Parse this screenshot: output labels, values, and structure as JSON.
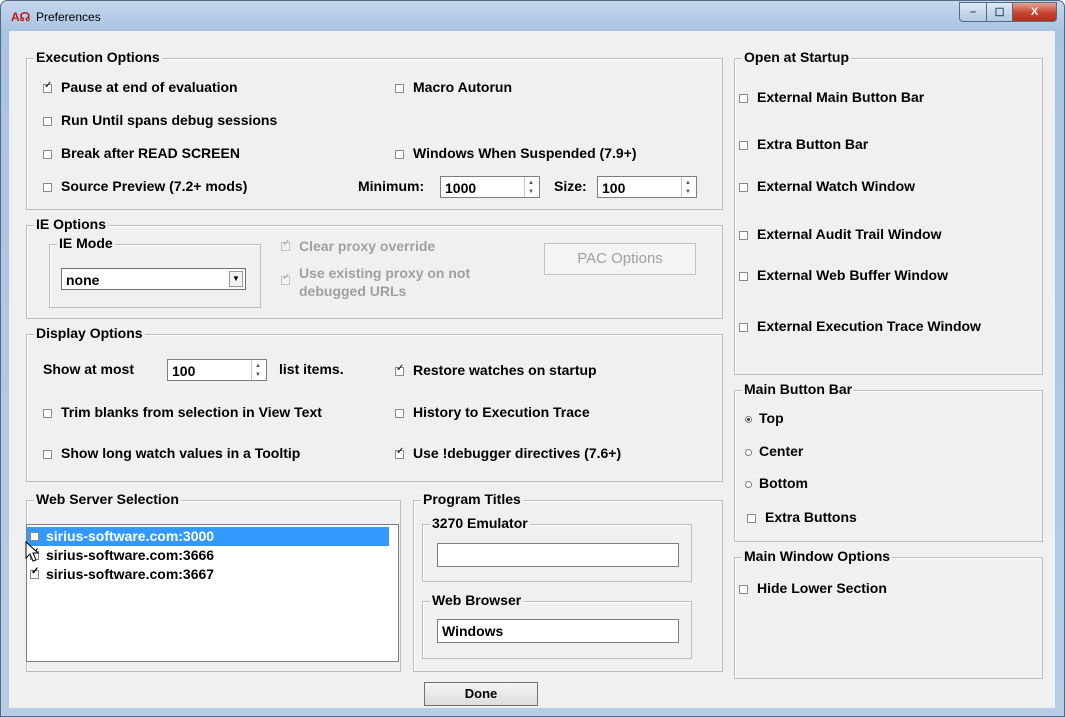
{
  "window": {
    "title": "Preferences",
    "controls": {
      "minimize": "–",
      "maximize": "☐",
      "close": "X"
    }
  },
  "execution_options": {
    "label": "Execution Options",
    "pause_at_end": {
      "label": "Pause at end of evaluation",
      "checked": true
    },
    "macro_autorun": {
      "label": "Macro Autorun",
      "checked": false
    },
    "run_until_spans": {
      "label": "Run Until spans debug sessions",
      "checked": false
    },
    "break_after_read_screen": {
      "label": "Break after READ SCREEN",
      "checked": false
    },
    "windows_when_suspended": {
      "label": "Windows When Suspended (7.9+)",
      "checked": false
    },
    "source_preview": {
      "label": "Source Preview (7.2+ mods)",
      "checked": false
    },
    "minimum_label": "Minimum:",
    "minimum_value": "1000",
    "size_label": "Size:",
    "size_value": "100"
  },
  "ie_options": {
    "label": "IE Options",
    "ie_mode_label": "IE Mode",
    "ie_mode_value": "none",
    "clear_proxy": {
      "label": "Clear proxy override",
      "checked": true
    },
    "use_existing_proxy": {
      "label_line1": "Use existing proxy on not",
      "label_line2": "debugged URLs",
      "checked": true
    },
    "pac_button": "PAC Options"
  },
  "display_options": {
    "label": "Display Options",
    "show_at_most_label": "Show at most",
    "show_at_most_value": "100",
    "list_items_label": "list items.",
    "restore_watches": {
      "label": "Restore watches on startup",
      "checked": true
    },
    "trim_blanks": {
      "label": "Trim blanks from selection in View Text",
      "checked": false
    },
    "history_to_trace": {
      "label": "History to Execution Trace",
      "checked": false
    },
    "show_long_watch": {
      "label": "Show long watch values in a Tooltip",
      "checked": false
    },
    "use_debugger_directives": {
      "label": "Use !debugger directives (7.6+)",
      "checked": true
    }
  },
  "web_server_selection": {
    "label": "Web Server Selection",
    "items": [
      {
        "text": "sirius-software.com:3000",
        "checked": false,
        "selected": true
      },
      {
        "text": "sirius-software.com:3666",
        "checked": true,
        "selected": false
      },
      {
        "text": "sirius-software.com:3667",
        "checked": true,
        "selected": false
      }
    ]
  },
  "program_titles": {
    "label": "Program Titles",
    "emulator_label": "3270 Emulator",
    "emulator_value": "",
    "browser_label": "Web Browser",
    "browser_value": "Windows"
  },
  "open_at_startup": {
    "label": "Open at Startup",
    "items": [
      {
        "label": "External Main Button Bar",
        "checked": false
      },
      {
        "label": "Extra Button Bar",
        "checked": false
      },
      {
        "label": "External Watch Window",
        "checked": false
      },
      {
        "label": "External Audit Trail Window",
        "checked": false
      },
      {
        "label": "External Web Buffer Window",
        "checked": false
      },
      {
        "label": "External Execution Trace Window",
        "checked": false
      }
    ]
  },
  "main_button_bar": {
    "label": "Main Button Bar",
    "top": "Top",
    "center": "Center",
    "bottom": "Bottom",
    "selected": "Top",
    "extra_buttons": {
      "label": "Extra Buttons",
      "checked": false
    }
  },
  "main_window_options": {
    "label": "Main Window Options",
    "hide_lower_section": {
      "label": "Hide Lower Section",
      "checked": false
    }
  },
  "done_button": "Done"
}
